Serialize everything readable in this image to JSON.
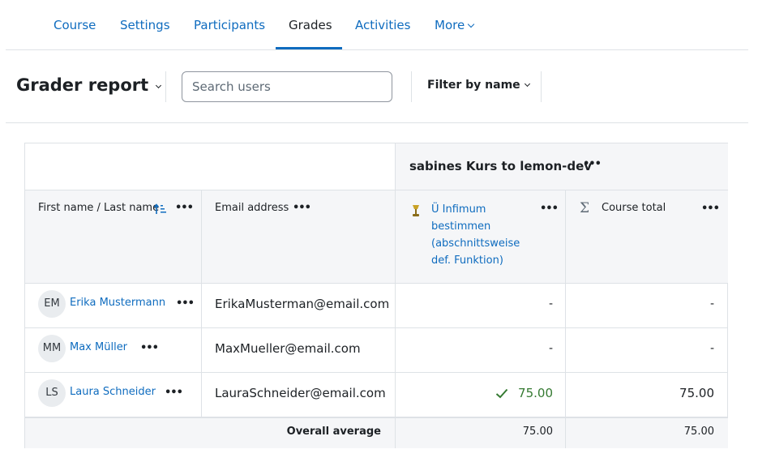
{
  "nav": {
    "tabs": [
      {
        "label": "Course"
      },
      {
        "label": "Settings"
      },
      {
        "label": "Participants"
      },
      {
        "label": "Grades"
      },
      {
        "label": "Activities"
      },
      {
        "label": "More"
      }
    ]
  },
  "header": {
    "title": "Grader report",
    "search_placeholder": "Search users",
    "filter_label": "Filter by name"
  },
  "table": {
    "category": "sabines Kurs to lemon-dev",
    "col_name": "First name / Last name",
    "col_email": "Email address",
    "col_item": "Ü Infimum bestimmen (abschnittsweise def. Funktion)",
    "col_total": "Course total",
    "dots": "•••",
    "rows": [
      {
        "initials": "EM",
        "name": "Erika Mustermann",
        "email": "ErikaMusterman@email.com",
        "item": "-",
        "total": "-"
      },
      {
        "initials": "MM",
        "name": "Max Müller",
        "email": "MaxMueller@email.com",
        "item": "-",
        "total": "-"
      },
      {
        "initials": "LS",
        "name": "Laura Schneider",
        "email": "LauraSchneider@email.com",
        "item": "75.00",
        "total": "75.00"
      }
    ],
    "avg_label": "Overall average",
    "avg_item": "75.00",
    "avg_total": "75.00"
  },
  "colors": {
    "link": "#0f6cbf",
    "graded": "#357a32",
    "border": "#dee2e6",
    "header_bg": "#f5f6f8"
  }
}
